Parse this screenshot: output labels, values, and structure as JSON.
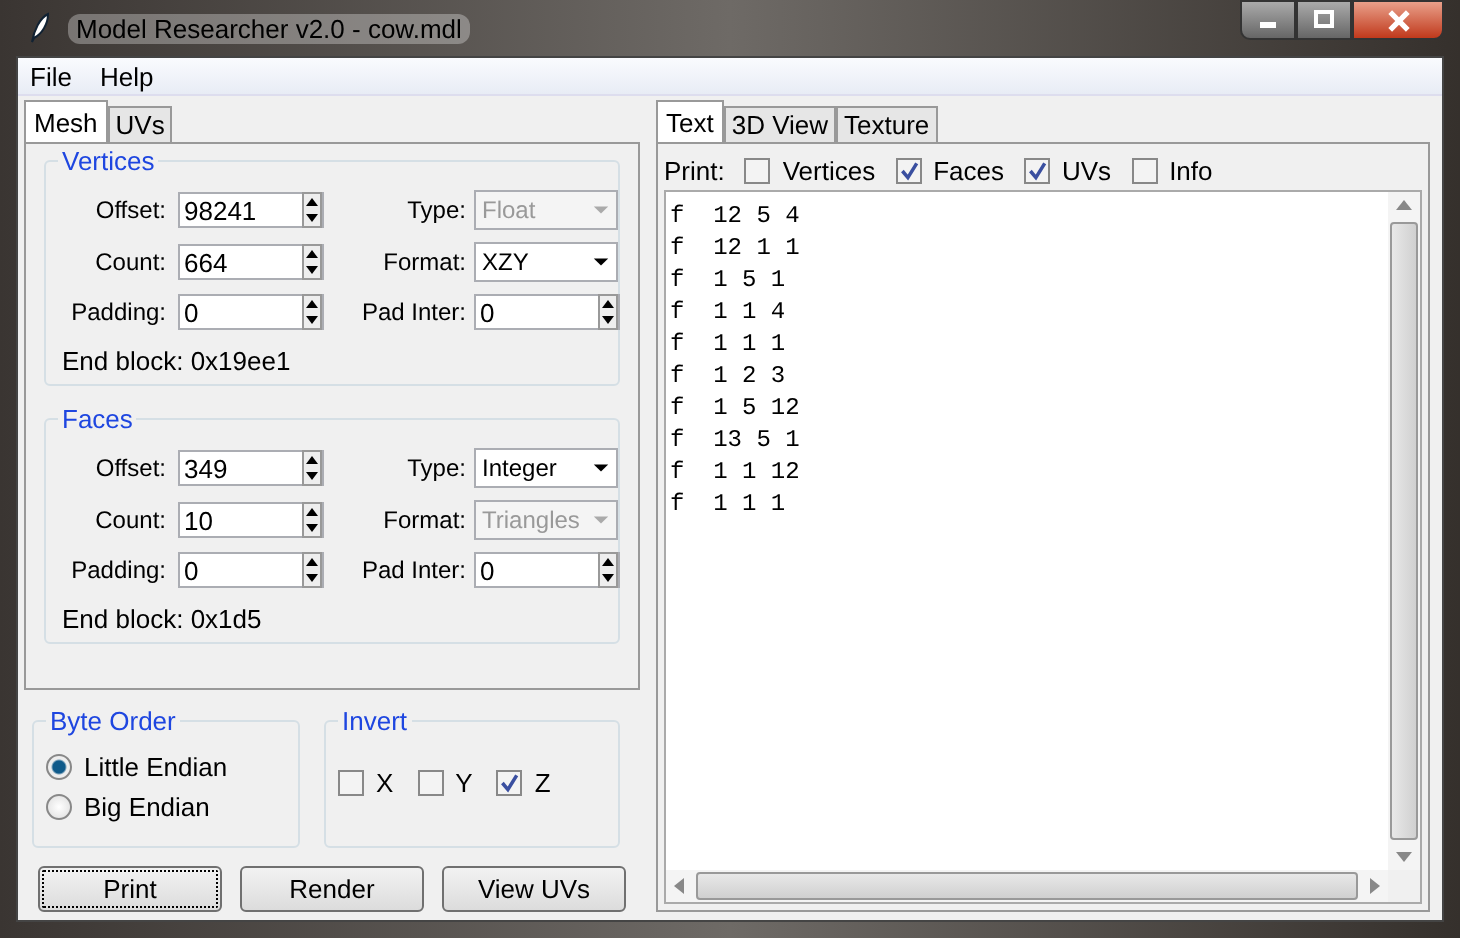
{
  "window": {
    "title": "Model Researcher v2.0 - cow.mdl"
  },
  "menu": [
    "File",
    "Help"
  ],
  "left_tabs": [
    {
      "label": "Mesh",
      "selected": true
    },
    {
      "label": "UVs",
      "selected": false
    }
  ],
  "groups": [
    {
      "title": "Vertices",
      "fields": [
        {
          "kind": "spin",
          "label": "Offset:",
          "value": "98241"
        },
        {
          "kind": "combo",
          "label": "Type:",
          "value": "Float",
          "disabled": true
        },
        {
          "kind": "spin",
          "label": "Count:",
          "value": "664"
        },
        {
          "kind": "combo",
          "label": "Format:",
          "value": "XZY",
          "disabled": false
        },
        {
          "kind": "spin",
          "label": "Padding:",
          "value": "0"
        },
        {
          "kind": "spin",
          "label": "Pad Inter:",
          "value": "0"
        }
      ],
      "end_block": "End block: 0x19ee1"
    },
    {
      "title": "Faces",
      "fields": [
        {
          "kind": "spin",
          "label": "Offset:",
          "value": "349"
        },
        {
          "kind": "combo",
          "label": "Type:",
          "value": "Integer",
          "disabled": false
        },
        {
          "kind": "spin",
          "label": "Count:",
          "value": "10"
        },
        {
          "kind": "combo",
          "label": "Format:",
          "value": "Triangles",
          "disabled": true
        },
        {
          "kind": "spin",
          "label": "Padding:",
          "value": "0"
        },
        {
          "kind": "spin",
          "label": "Pad Inter:",
          "value": "0"
        }
      ],
      "end_block": "End block: 0x1d5"
    }
  ],
  "byte_order": {
    "title": "Byte Order",
    "options": [
      {
        "label": "Little Endian",
        "selected": true
      },
      {
        "label": "Big Endian",
        "selected": false
      }
    ]
  },
  "invert": {
    "title": "Invert",
    "options": [
      {
        "label": "X",
        "checked": false
      },
      {
        "label": "Y",
        "checked": false
      },
      {
        "label": "Z",
        "checked": true
      }
    ]
  },
  "buttons": [
    {
      "label": "Print",
      "focused": true
    },
    {
      "label": "Render",
      "focused": false
    },
    {
      "label": "View UVs",
      "focused": false
    }
  ],
  "right_tabs": [
    {
      "label": "Text",
      "selected": true
    },
    {
      "label": "3D View",
      "selected": false
    },
    {
      "label": "Texture",
      "selected": false
    }
  ],
  "print": {
    "label": "Print:",
    "options": [
      {
        "label": "Vertices",
        "checked": false
      },
      {
        "label": "Faces",
        "checked": true
      },
      {
        "label": "UVs",
        "checked": true
      },
      {
        "label": "Info",
        "checked": false
      }
    ]
  },
  "text_lines": [
    "f  12 5 4",
    "f  12 1 1",
    "f  1 5 1",
    "f  1 1 4",
    "f  1 1 1",
    "f  1 2 3",
    "f  1 5 12",
    "f  13 5 1",
    "f  1 1 12",
    "f  1 1 1"
  ]
}
